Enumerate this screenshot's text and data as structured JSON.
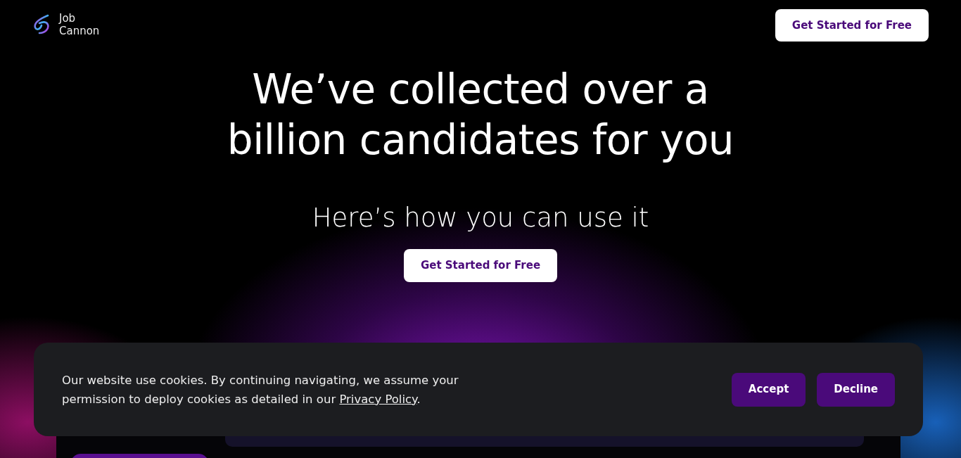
{
  "header": {
    "logo_text": [
      "Job",
      "Cannon"
    ],
    "cta": "Get Started for Free"
  },
  "hero": {
    "title_lines": [
      "We’ve collected over a",
      "billion candidates for you"
    ],
    "subtitle": "Here’s how you can use it",
    "cta": "Get Started for Free"
  },
  "cookie_banner": {
    "text_before": "Our website use cookies. By continuing navigating, we assume your permission to deploy cookies as detailed in our ",
    "link": "Privacy Policy",
    "text_after": ".",
    "buttons": [
      "Accept",
      "Decline"
    ]
  }
}
